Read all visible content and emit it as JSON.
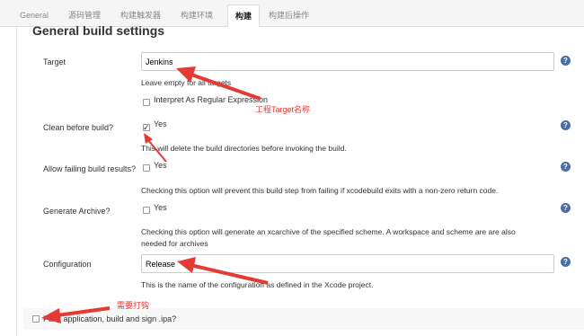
{
  "tabs": [
    "General",
    "源码管理",
    "构建触发器",
    "构建环境",
    "构建",
    "构建后操作"
  ],
  "section_title": "General build settings",
  "target": {
    "label": "Target",
    "value": "Jenkins",
    "hint": "Leave empty for all targets",
    "regex_label": "Interpret As Regular Expression"
  },
  "clean": {
    "label": "Clean before build?",
    "yes": "Yes",
    "desc": "This will delete the build directories before invoking the build."
  },
  "allow_failing": {
    "label": "Allow failing build results?",
    "yes": "Yes",
    "desc": "Checking this option will prevent this build step from failing if xcodebuild exits with a non-zero return code."
  },
  "archive": {
    "label": "Generate Archive?",
    "yes": "Yes",
    "desc_line1": "Checking this option will generate an xcarchive of the specified scheme. A workspace and scheme are are also",
    "desc_line2": "needed for archives"
  },
  "configuration": {
    "label": "Configuration",
    "value": "Release",
    "desc": "This is the name of the configuration as defined in the Xcode project."
  },
  "pack": {
    "label": "Pack application, build and sign .ipa?"
  },
  "annotations": {
    "target_note": "工程Target名称",
    "check_note": "需要打钩"
  },
  "help_glyph": "?",
  "colors": {
    "annotation": "#e53935",
    "help": "#4a6fa5"
  }
}
